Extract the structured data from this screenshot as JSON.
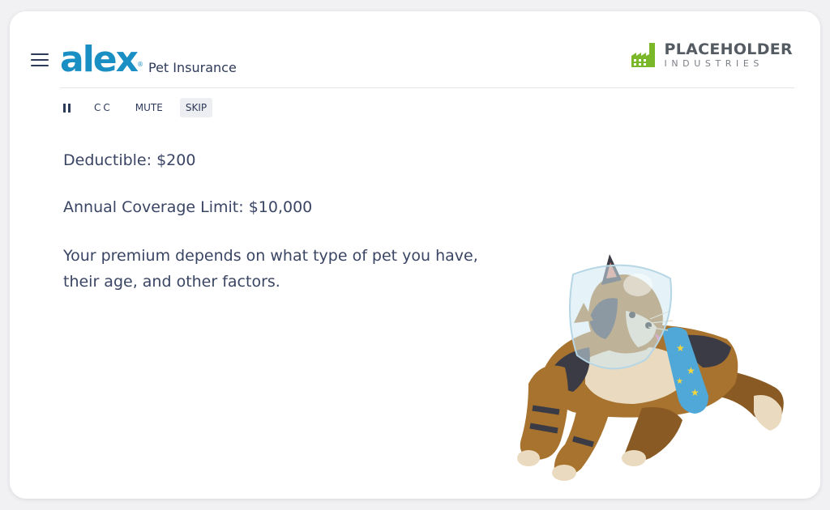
{
  "header": {
    "menu_icon": "hamburger-menu-icon",
    "brand_logo": "alex",
    "brand_registered": "®",
    "brand_subtitle": "Pet Insurance",
    "company_name": "PLACEHOLDER",
    "company_sub": "INDUSTRIES",
    "company_icon": "factory-icon",
    "colors": {
      "brand": "#1a8fc4",
      "company_icon": "#7ab829",
      "text": "#2e3a59"
    }
  },
  "controls": {
    "pause_icon": "pause-icon",
    "cc_label": "CC",
    "mute_label": "MUTE",
    "skip_label": "SKIP"
  },
  "content": {
    "deductible": "Deductible: $200",
    "coverage_limit": "Annual Coverage Limit: $10,000",
    "premium_line1": "Your premium depends on what type of pet you have,",
    "premium_line2": "their age, and other factors."
  },
  "illustration": {
    "icon": "calico-cat-with-cone-and-cast-illustration"
  }
}
